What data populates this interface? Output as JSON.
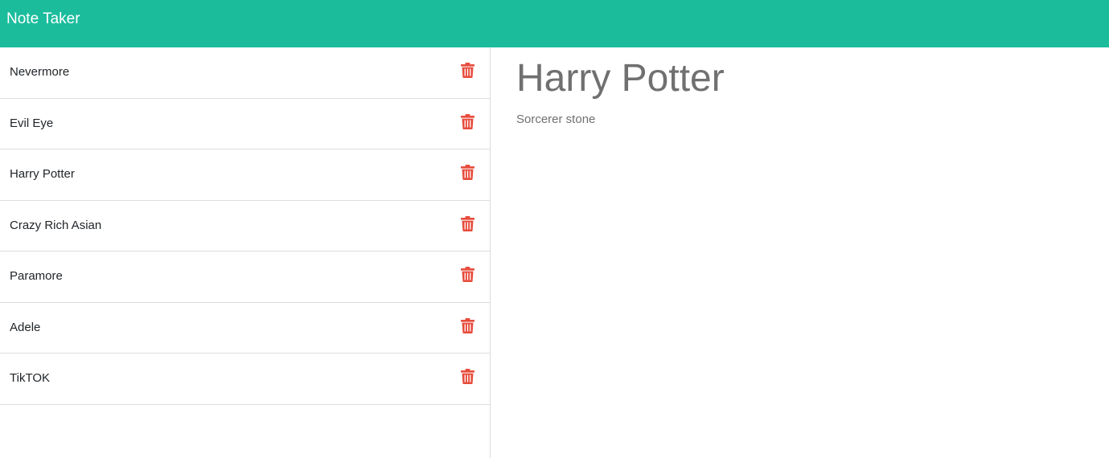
{
  "app": {
    "title": "Note Taker",
    "accent_color": "#1abc9c",
    "delete_color": "#e74c3c"
  },
  "notes": [
    {
      "title": "Nevermore"
    },
    {
      "title": "Evil Eye"
    },
    {
      "title": "Harry Potter"
    },
    {
      "title": "Crazy Rich Asian"
    },
    {
      "title": "Paramore"
    },
    {
      "title": "Adele"
    },
    {
      "title": "TikTOK"
    }
  ],
  "active_note": {
    "title": "Harry Potter",
    "text": "Sorcerer stone"
  },
  "icons": {
    "delete": "trash-icon"
  }
}
